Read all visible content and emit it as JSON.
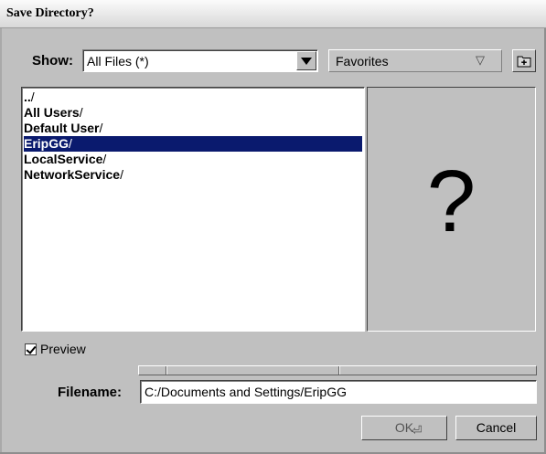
{
  "window": {
    "title": "Save Directory?"
  },
  "toolbar": {
    "show_label": "Show:",
    "filter_value": "All Files (*)",
    "favorites_label": "Favorites",
    "favorites_arrow": "▽",
    "new_folder_icon": "new-folder-icon"
  },
  "file_list": {
    "items": [
      {
        "name": "..",
        "suffix": "/",
        "selected": false
      },
      {
        "name": "All Users",
        "suffix": "/",
        "selected": false
      },
      {
        "name": "Default User",
        "suffix": "/",
        "selected": false
      },
      {
        "name": "EripGG",
        "suffix": "/",
        "selected": true
      },
      {
        "name": "LocalService",
        "suffix": "/",
        "selected": false
      },
      {
        "name": "NetworkService",
        "suffix": "/",
        "selected": false
      }
    ]
  },
  "preview": {
    "placeholder_glyph": "?",
    "checkbox_label": "Preview",
    "checked": true
  },
  "filename": {
    "label": "Filename:",
    "value": "C:/Documents and Settings/EripGG"
  },
  "buttons": {
    "ok_label": "OK",
    "ok_enter_glyph": "⏎",
    "cancel_label": "Cancel"
  },
  "colors": {
    "selection_bg": "#0a1a6e",
    "selection_fg": "#ffffff",
    "window_bg": "#c0c0c0"
  }
}
